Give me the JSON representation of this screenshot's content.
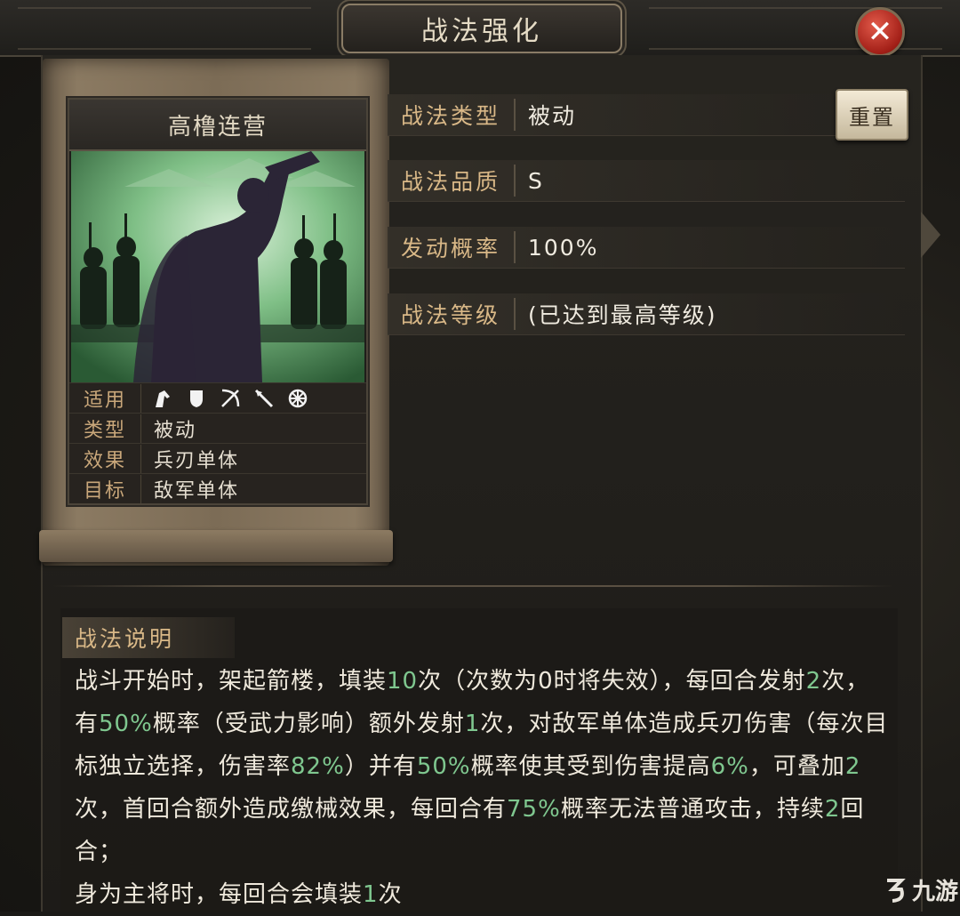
{
  "window": {
    "title": "战法强化",
    "close_symbol": "✕"
  },
  "skill_card": {
    "name": "高橹连营",
    "rows": {
      "applicable_label": "适用",
      "type_label": "类型",
      "type_value": "被动",
      "effect_label": "效果",
      "effect_value": "兵刃单体",
      "target_label": "目标",
      "target_value": "敌军单体"
    },
    "unit_icons": [
      "cavalry-icon",
      "shield-icon",
      "bow-icon",
      "spear-icon",
      "siege-icon"
    ]
  },
  "info": {
    "type_label": "战法类型",
    "type_value": "被动",
    "quality_label": "战法品质",
    "quality_value": "S",
    "rate_label": "发动概率",
    "rate_value": "100%",
    "level_label": "战法等级",
    "level_value": "(已达到最高等级)"
  },
  "reset_button": {
    "label": "重置"
  },
  "description": {
    "heading": "战法说明",
    "segments": [
      {
        "t": "战斗开始时，架起箭楼，填装",
        "hl": false
      },
      {
        "t": "10",
        "hl": true
      },
      {
        "t": "次（次数为0时将失效），每回合发射",
        "hl": false
      },
      {
        "t": "2",
        "hl": true
      },
      {
        "t": "次，有",
        "hl": false
      },
      {
        "t": "50%",
        "hl": true
      },
      {
        "t": "概率（受武力影响）额外发射",
        "hl": false
      },
      {
        "t": "1",
        "hl": true
      },
      {
        "t": "次，对敌军单体造成兵刃伤害（每次目标独立选择，伤害率",
        "hl": false
      },
      {
        "t": "82%",
        "hl": true
      },
      {
        "t": "）并有",
        "hl": false
      },
      {
        "t": "50%",
        "hl": true
      },
      {
        "t": "概率使其受到伤害提高",
        "hl": false
      },
      {
        "t": "6%",
        "hl": true
      },
      {
        "t": "，可叠加",
        "hl": false
      },
      {
        "t": "2",
        "hl": true
      },
      {
        "t": "次，首回合额外造成缴械效果，每回合有",
        "hl": false
      },
      {
        "t": "75%",
        "hl": true
      },
      {
        "t": "概率无法普通攻击，持续",
        "hl": false
      },
      {
        "t": "2",
        "hl": true
      },
      {
        "t": "回合；",
        "hl": false
      },
      {
        "t": "BR",
        "hl": false
      },
      {
        "t": "身为主将时，每回合会填装",
        "hl": false
      },
      {
        "t": "1",
        "hl": true
      },
      {
        "t": "次",
        "hl": false
      }
    ]
  },
  "watermark": {
    "text": "九游"
  },
  "colors": {
    "highlight": "#7fc78f",
    "label_gold": "#d9b887",
    "close_red": "#b82a1f"
  }
}
